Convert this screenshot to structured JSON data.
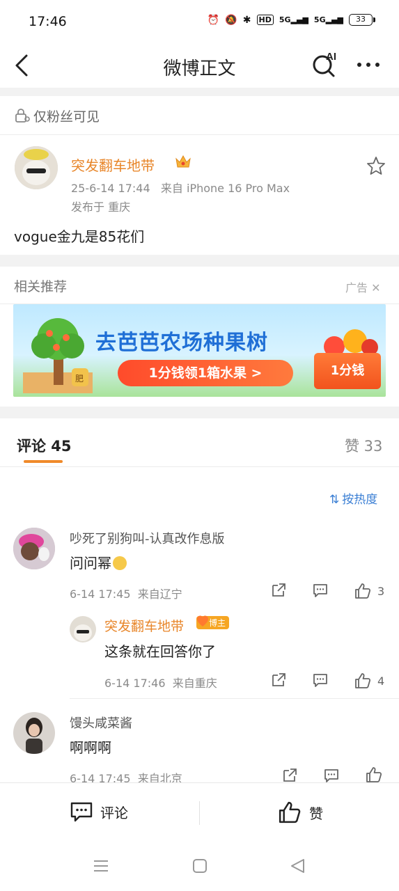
{
  "status_bar": {
    "time": "17:46",
    "network_label_1": "5G",
    "network_label_2": "5G",
    "battery": "33"
  },
  "header": {
    "title": "微博正文",
    "ai_label": "AI"
  },
  "visibility": {
    "label": "仅粉丝可见"
  },
  "post": {
    "author": "突发翻车地带",
    "time": "25-6-14 17:44",
    "source": "来自 iPhone 16 Pro Max",
    "location": "发布于 重庆",
    "text": "vogue金九是85花们"
  },
  "recommend": {
    "title": "相关推荐",
    "ad_label": "广告",
    "ad_headline": "去芭芭农场种果树",
    "ad_cta": "1分钱领1箱水果 >",
    "ad_box": "1分钱",
    "ad_jar": "肥"
  },
  "comments": {
    "tab_label": "评论 45",
    "likes_tab_label": "赞 33",
    "sort_label": "按热度",
    "items": [
      {
        "name": "吵死了别狗叫-认真改作息版",
        "text": "问问幂",
        "time": "6-14 17:45",
        "source": "来自辽宁",
        "likes": "3"
      },
      {
        "name": "突发翻车地带",
        "badge": "博主",
        "text": "这条就在回答你了",
        "time": "6-14 17:46",
        "source": "来自重庆",
        "likes": "4"
      },
      {
        "name": "馒头咸菜酱",
        "text": "啊啊啊",
        "time": "6-14 17:45",
        "source": "来自北京"
      }
    ]
  },
  "bottom_bar": {
    "comment_label": "评论",
    "like_label": "赞"
  },
  "colors": {
    "accent": "#f08a2a",
    "author_orange": "#e8862a",
    "link_blue": "#3b7fd4"
  }
}
